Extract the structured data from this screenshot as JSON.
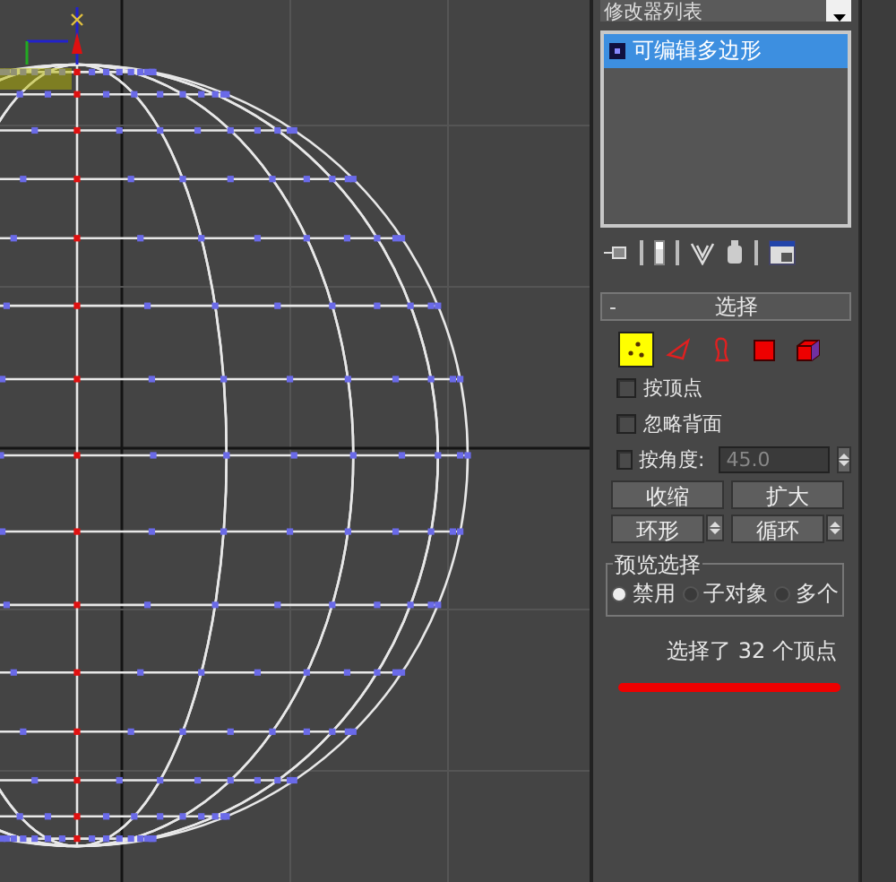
{
  "modifier_list": {
    "label": "修改器列表"
  },
  "modifier_stack": [
    {
      "label": "可编辑多边形",
      "selected": true
    }
  ],
  "selection": {
    "collapse": "-",
    "title": "选择",
    "levels": [
      {
        "kind": "vertex",
        "selected": true
      },
      {
        "kind": "edge",
        "selected": false
      },
      {
        "kind": "border",
        "selected": false
      },
      {
        "kind": "polygon",
        "selected": false
      },
      {
        "kind": "element",
        "selected": false
      }
    ],
    "options": [
      {
        "label": "按顶点",
        "checked": false
      },
      {
        "label": "忽略背面",
        "checked": false
      }
    ],
    "by_angle": {
      "label": "按角度:",
      "checked": false,
      "value": "45.0"
    },
    "buttons": [
      "收缩",
      "扩大"
    ],
    "spinner_buttons": [
      "环形",
      "循环"
    ],
    "preview": {
      "title": "预览选择",
      "options": [
        {
          "label": "禁用",
          "selected": true
        },
        {
          "label": "子对象",
          "selected": false
        },
        {
          "label": "多个",
          "selected": false
        }
      ]
    },
    "status": "选择了 32 个顶点"
  }
}
